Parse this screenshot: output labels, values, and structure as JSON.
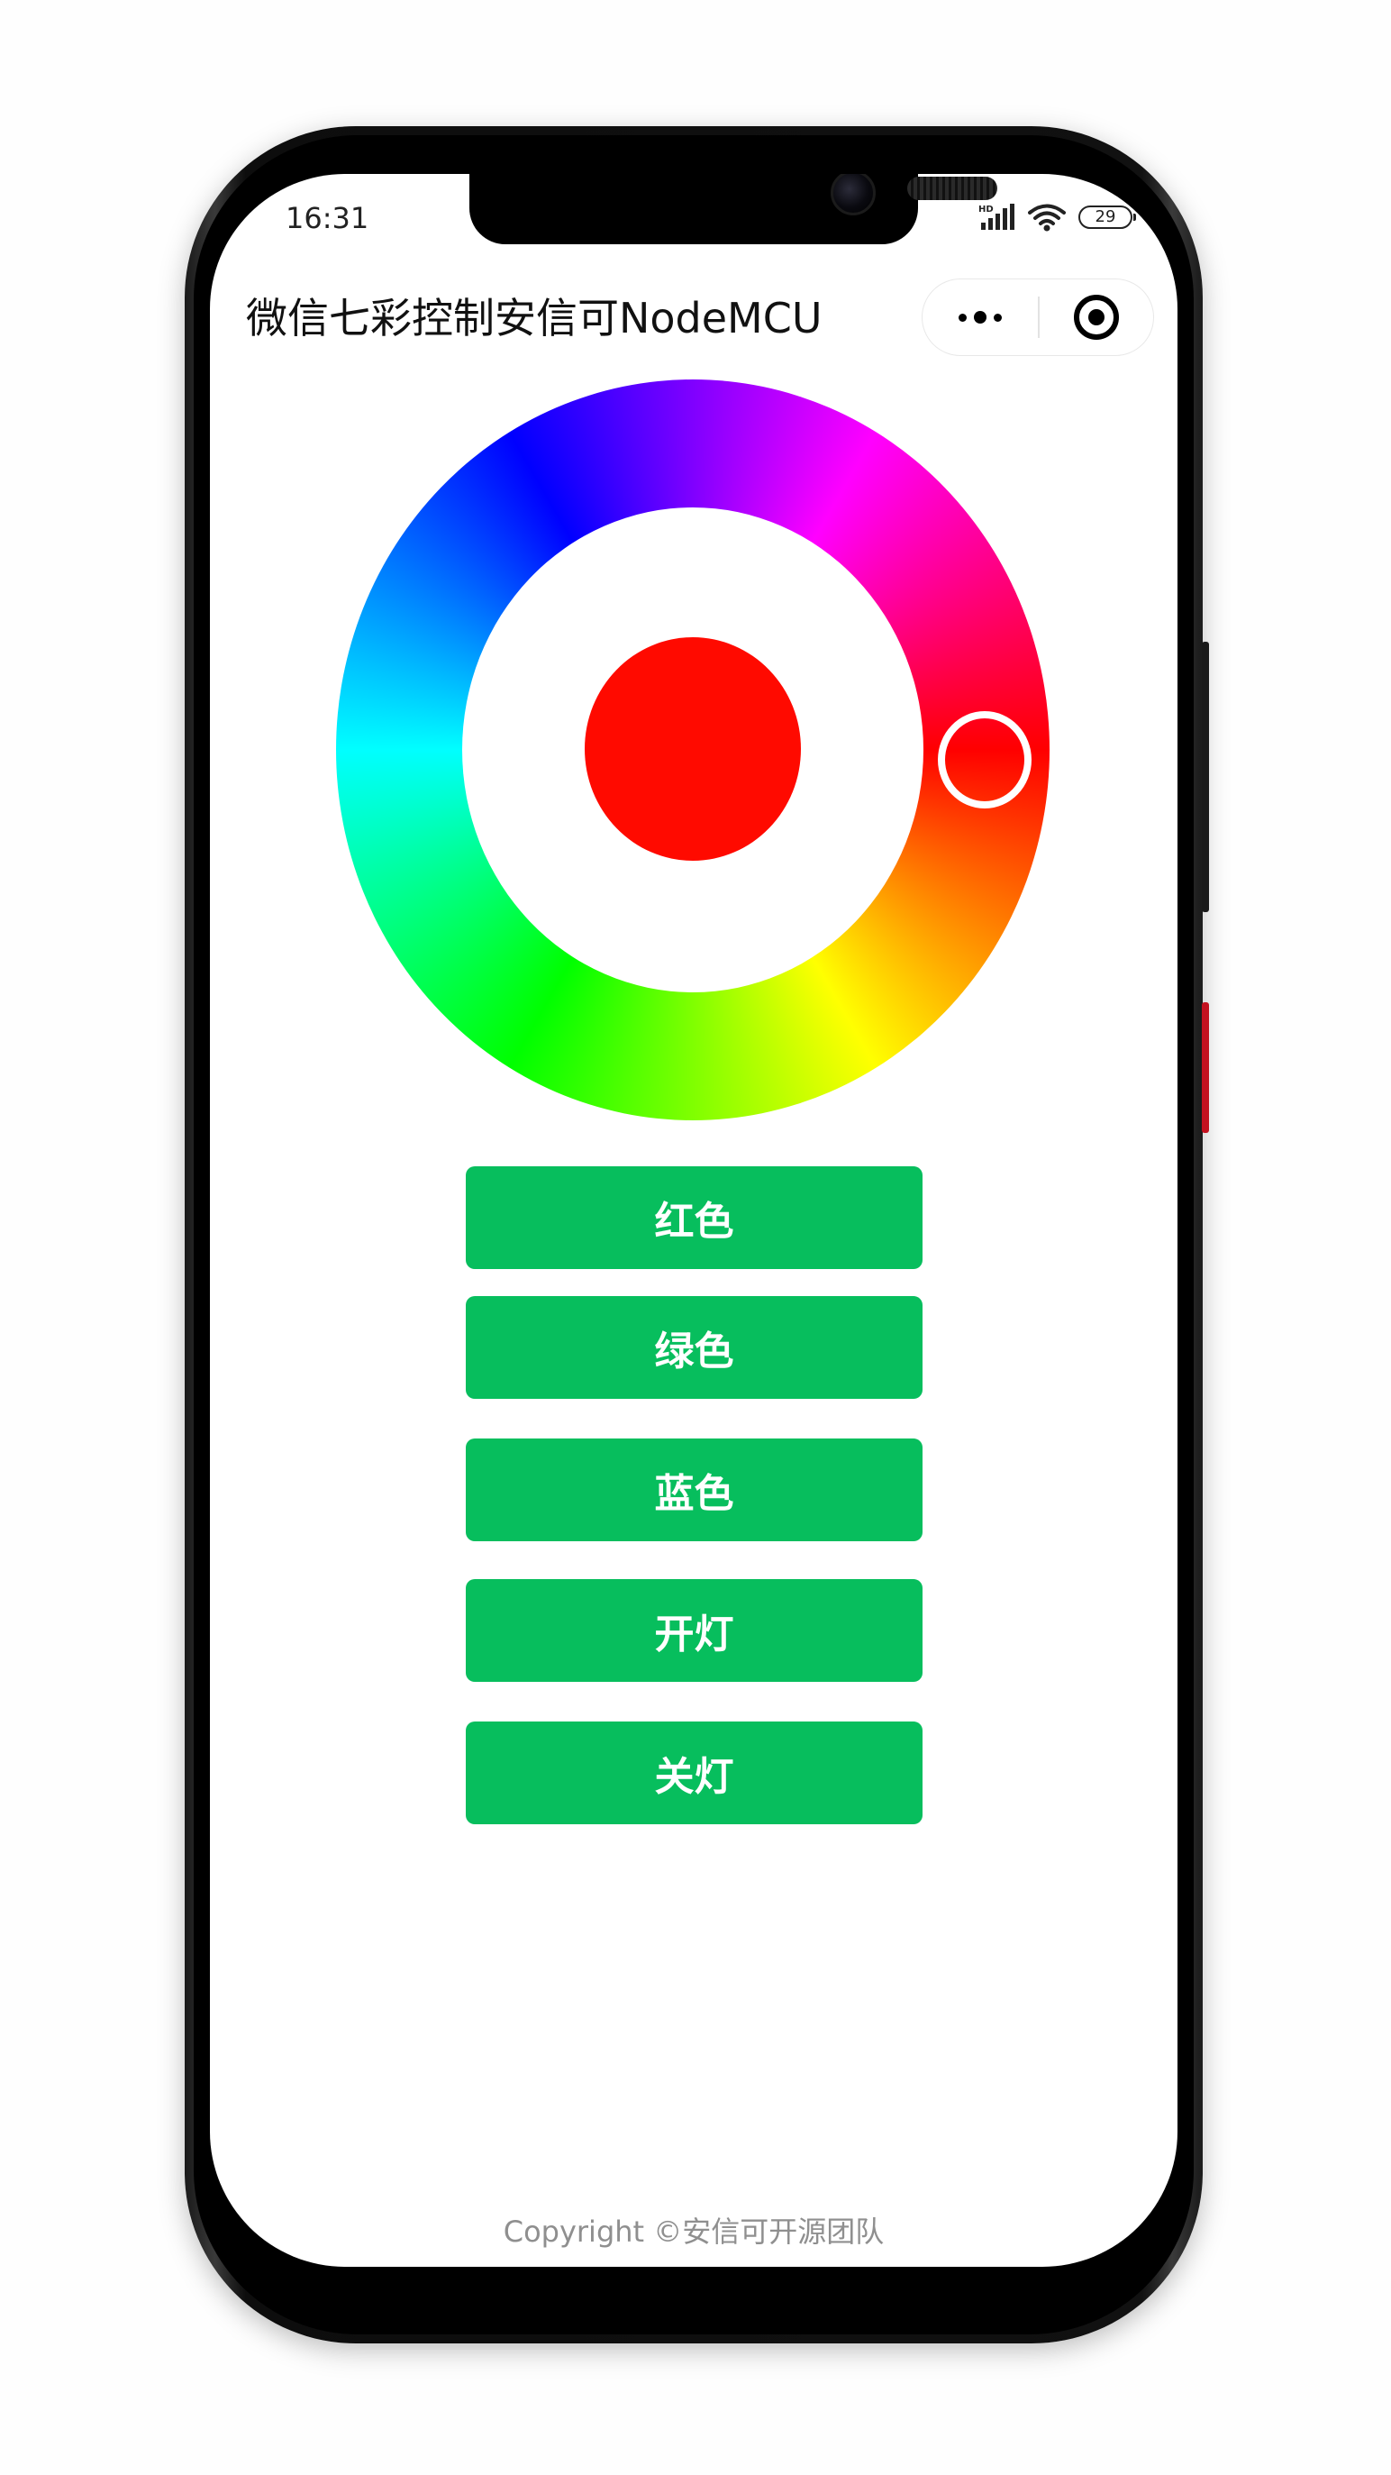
{
  "status_bar": {
    "time": "16:31",
    "battery": "29",
    "signal_label": "HD",
    "icons": [
      "signal-icon",
      "wifi-icon",
      "battery-icon"
    ]
  },
  "nav": {
    "title": "微信七彩控制安信可NodeMCU",
    "capsule_icons": [
      "more-dots-icon",
      "close-target-icon"
    ]
  },
  "color_wheel": {
    "selected_color": "#ff0a00",
    "hue_degrees": 0
  },
  "buttons": {
    "red": "红色",
    "green": "绿色",
    "blue": "蓝色",
    "on": "开灯",
    "off": "关灯"
  },
  "footer": {
    "copyright": "Copyright ©安信可开源团队"
  },
  "colors": {
    "button_green": "#07be5d",
    "button_text": "#ffffff",
    "footer_text": "#8f8f8f"
  }
}
